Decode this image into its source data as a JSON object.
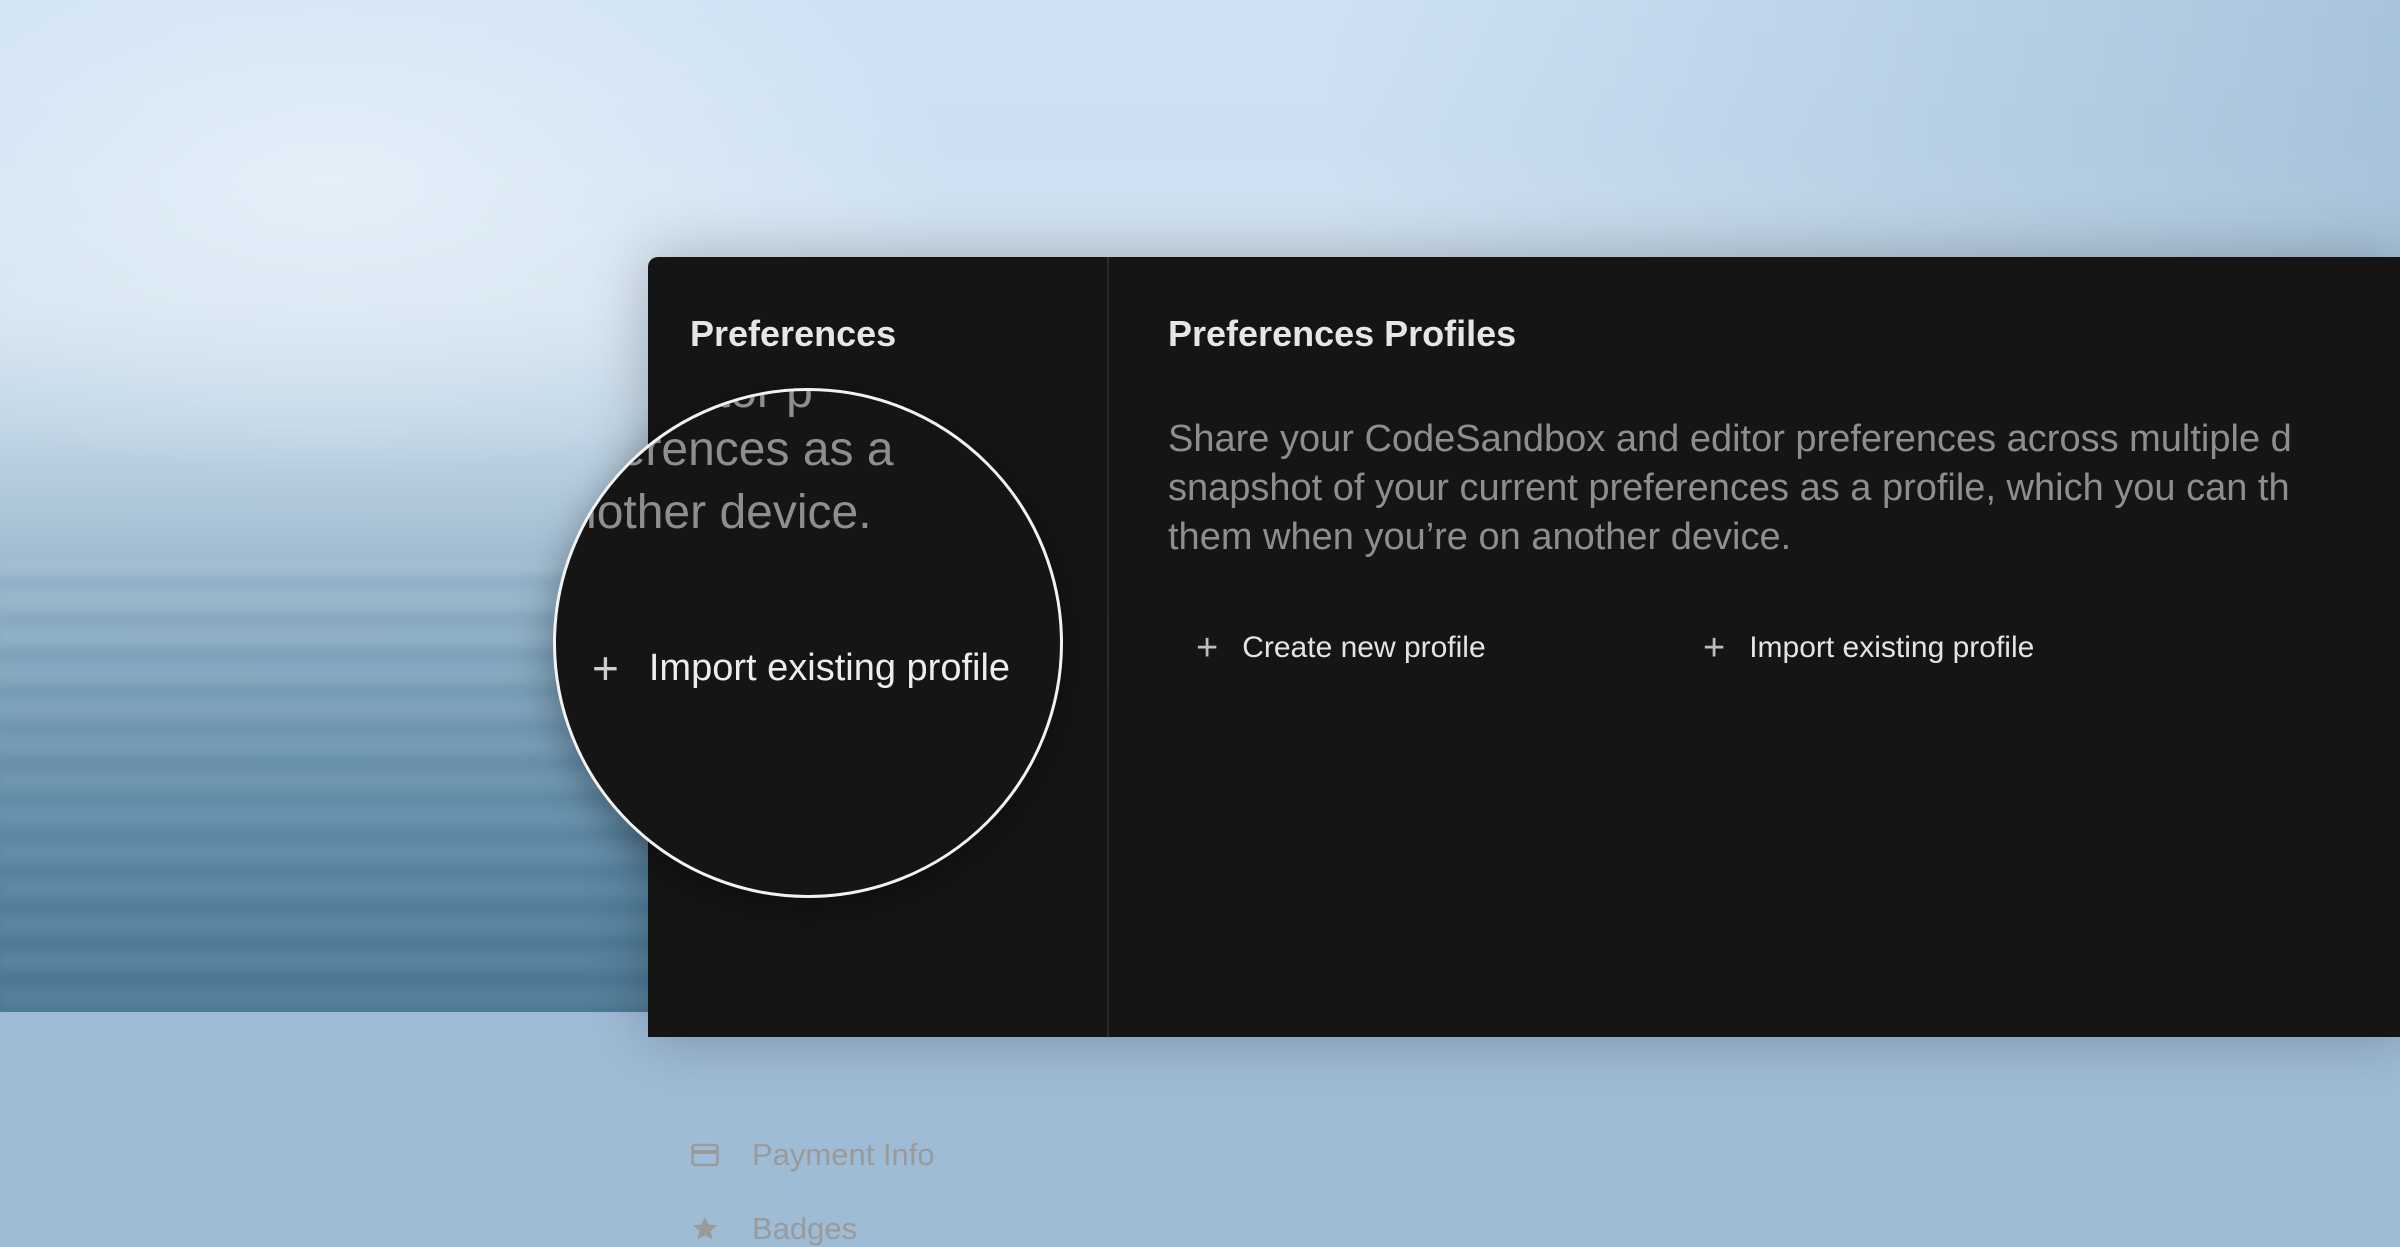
{
  "sidebar": {
    "title": "Preferences",
    "items": [
      {
        "label": "Payment Info",
        "icon": "credit-card-icon"
      },
      {
        "label": "Badges",
        "icon": "star-icon"
      }
    ]
  },
  "main": {
    "title": "Preferences Profiles",
    "description_lines": [
      "Share your CodeSandbox and editor preferences across multiple d",
      "snapshot of your current preferences as a profile, which you can th",
      "them when you’re on another device."
    ],
    "actions": {
      "create_label": "Create new profile",
      "import_label": "Import existing profile",
      "plus_glyph": "+"
    }
  },
  "magnifier": {
    "lines": [
      "nd editor p",
      "preferences as a",
      "nother device."
    ],
    "action_label": "Import existing profile",
    "plus_glyph": "+"
  }
}
